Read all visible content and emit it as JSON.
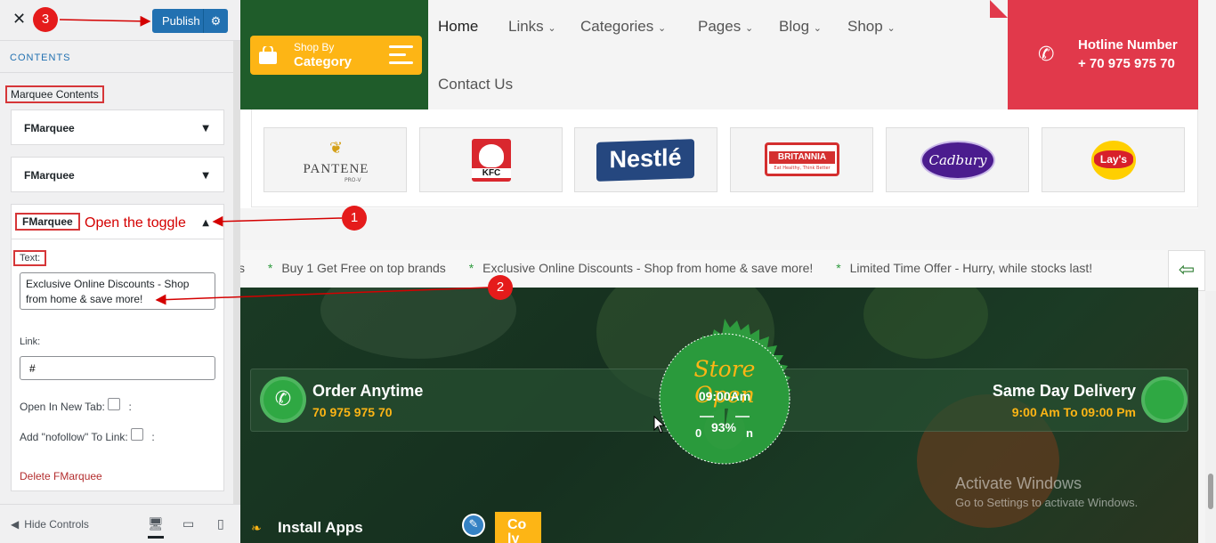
{
  "customizer": {
    "publish_label": "Publish",
    "section_label": "CONTENTS",
    "marquee_title": "Marquee Contents",
    "items": [
      {
        "label": "FMarquee"
      },
      {
        "label": "FMarquee"
      },
      {
        "label": "FMarquee"
      }
    ],
    "open_item": {
      "text_label": "Text:",
      "text_value": "Exclusive Online Discounts - Shop from home & save more!",
      "link_label": "Link:",
      "link_value": "#",
      "new_tab_label": "Open In New Tab:",
      "nofollow_label": "Add \"nofollow\" To Link:",
      "suffix": ":",
      "delete_label": "Delete FMarquee"
    },
    "hide_controls_label": "Hide Controls",
    "accent_color": "#2271b1"
  },
  "annotations": {
    "step1": "1",
    "step2": "2",
    "step3": "3",
    "step1_text": "Open the toggle",
    "color": "#e51b1b"
  },
  "site": {
    "shop_by_small": "Shop By",
    "shop_by_big": "Category",
    "nav": [
      {
        "label": "Home",
        "dropdown": false
      },
      {
        "label": "Links",
        "dropdown": true
      },
      {
        "label": "Categories",
        "dropdown": true
      },
      {
        "label": "Pages",
        "dropdown": true
      },
      {
        "label": "Blog",
        "dropdown": true
      },
      {
        "label": "Shop",
        "dropdown": true
      },
      {
        "label": "Contact Us",
        "dropdown": false
      }
    ],
    "hotline_label": "Hotline Number",
    "hotline_number": "+ 70 975 975 70",
    "brands": [
      "PANTENE",
      "KFC",
      "Nestlé",
      "BRITANNIA",
      "Cadbury",
      "Lay's"
    ],
    "pantene_sub": "PRO-V",
    "britannia_sub": "Eat Healthy, Think Better",
    "marquee": {
      "lead": "s",
      "items": [
        "Buy 1 Get Free on top brands",
        "Exclusive Online Discounts - Shop from home & save more!",
        "Limited Time Offer - Hurry, while stocks last!"
      ],
      "star": "*"
    },
    "order": {
      "title": "Order Anytime",
      "number": "70 975 975 70"
    },
    "delivery": {
      "title": "Same Day Delivery",
      "hours": "9:00 Am To 09:00 Pm"
    },
    "store": {
      "title": "Store Open",
      "time": "09:00Am",
      "obscured": "0",
      "obscured_tail": "n",
      "percent": "93%"
    },
    "install_label": "Install Apps",
    "co_label": "Co ly",
    "windows_activate_title": "Activate Windows",
    "windows_activate_sub": "Go to Settings to activate Windows.",
    "brand_green": "#1f5c2a",
    "brand_yellow": "#fdb515",
    "hotline_red": "#e1394b"
  }
}
